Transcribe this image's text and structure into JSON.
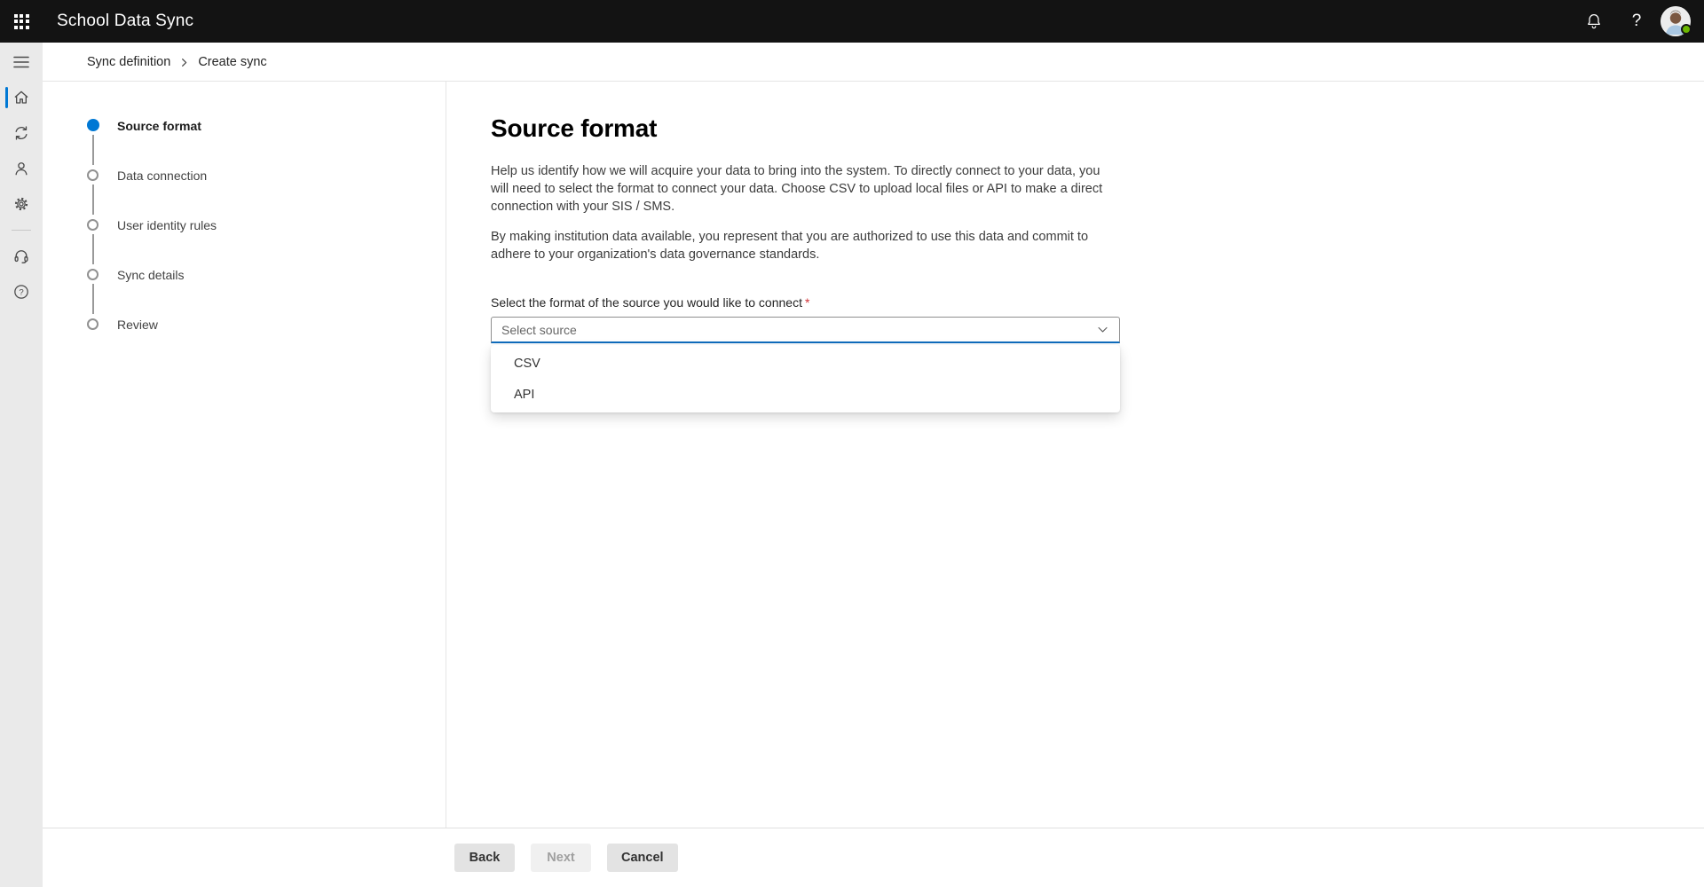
{
  "app": {
    "title": "School Data Sync"
  },
  "topbar": {
    "help_glyph": "?",
    "icons": [
      "app-launcher-icon",
      "bell-icon",
      "help-icon",
      "avatar"
    ],
    "presence": "available"
  },
  "breadcrumb": {
    "items": [
      {
        "label": "Sync definition"
      },
      {
        "label": "Create sync"
      }
    ]
  },
  "sidebar": {
    "icons": [
      "global-nav-menu-icon",
      "home-icon",
      "sync-icon",
      "people-icon",
      "settings-icon",
      "headset-icon",
      "help-circle-icon"
    ],
    "active": "home"
  },
  "stepper": {
    "steps": [
      {
        "label": "Source format",
        "state": "active"
      },
      {
        "label": "Data connection",
        "state": "upcoming"
      },
      {
        "label": "User identity rules",
        "state": "upcoming"
      },
      {
        "label": "Sync details",
        "state": "upcoming"
      },
      {
        "label": "Review",
        "state": "upcoming"
      }
    ]
  },
  "main": {
    "title": "Source format",
    "paragraphs": [
      "Help us identify how we will acquire your data to bring into the system.  To directly connect to your data, you will need to select the format to connect your data. Choose CSV to upload local files or API to make a direct connection with your SIS / SMS.",
      "By making institution data available, you represent that you are authorized to use this data and commit to adhere to your organization's data governance standards."
    ],
    "field": {
      "label": "Select the format of the source you would like to connect",
      "required_mark": "*",
      "placeholder": "Select source",
      "options": [
        "CSV",
        "API"
      ]
    }
  },
  "footer": {
    "back_label": "Back",
    "next_label": "Next",
    "cancel_label": "Cancel"
  },
  "colors": {
    "accent_blue": "#0078d4",
    "combobox_underline": "#0f6cbd",
    "topbar_bg": "#131313",
    "sidebar_bg": "#eaeaea",
    "presence_green": "#6bb700",
    "required_red": "#d13438"
  }
}
